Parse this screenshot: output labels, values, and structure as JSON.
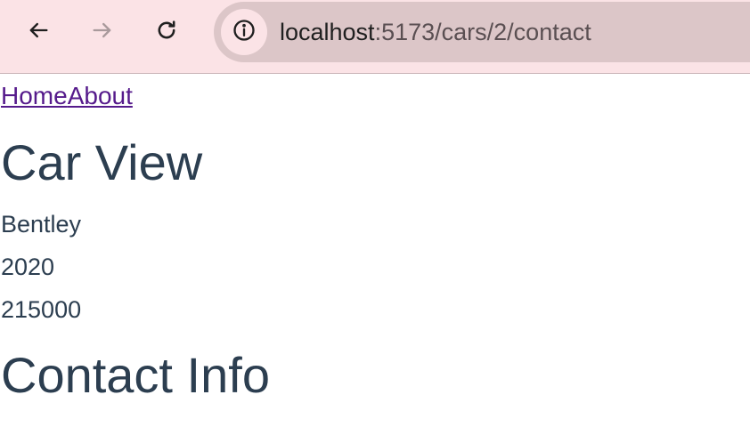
{
  "browser": {
    "url_host": "localhost",
    "url_path": ":5173/cars/2/contact",
    "colors": {
      "toolbar_bg": "#fbe3e6",
      "omnibox_bg": "#dcc6c8"
    },
    "icons": {
      "back": "arrow-left-icon",
      "forward": "arrow-right-icon",
      "reload": "reload-icon",
      "site_info": "info-icon"
    }
  },
  "page": {
    "nav": {
      "home": "Home",
      "about": "About"
    },
    "car_view": {
      "heading": "Car View",
      "name": "Bentley",
      "year": "2020",
      "price": "215000"
    },
    "contact": {
      "heading": "Contact Info"
    },
    "colors": {
      "text": "#2c3e50",
      "link": "#551a8b"
    }
  }
}
